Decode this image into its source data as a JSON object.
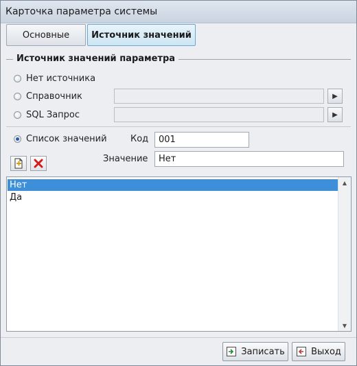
{
  "window": {
    "title": "Карточка параметра системы"
  },
  "tabs": [
    {
      "label": "Основные",
      "active": false
    },
    {
      "label": "Источник значений",
      "active": true
    }
  ],
  "group": {
    "title": "Источник значений параметра"
  },
  "source_options": {
    "none": "Нет источника",
    "reference": "Справочник",
    "sql": "SQL Запрос",
    "list": "Список значений"
  },
  "selected_source": "list",
  "fields": {
    "code_label": "Код",
    "code_value": "001",
    "value_label": "Значение",
    "value_value": "Нет"
  },
  "list_items": [
    "Нет",
    "Да"
  ],
  "selected_index": 0,
  "buttons": {
    "save": "Записать",
    "exit": "Выход"
  },
  "colors": {
    "selection": "#3c8fd8",
    "active_tab": "#cde6f3",
    "delete_icon": "#d21c1c"
  },
  "icons": {
    "add": "new-document-icon",
    "delete": "delete-cross-icon",
    "save": "save-icon",
    "exit": "exit-door-icon"
  }
}
